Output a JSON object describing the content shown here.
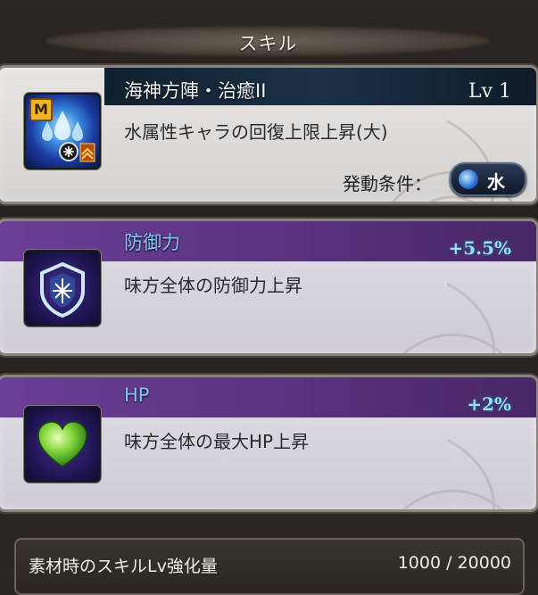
{
  "section": {
    "title": "スキル"
  },
  "skill": {
    "name": "海神方陣・治癒II",
    "level": "Lv 1",
    "badge": "M",
    "description": "水属性キャラの回復上限上昇(大)",
    "condition_label": "発動条件：",
    "element": "水",
    "icon": "water-skill-icon"
  },
  "effects": [
    {
      "name": "防御力",
      "value": "+5.5%",
      "description": "味方全体の防御力上昇",
      "icon": "shield-icon"
    },
    {
      "name": "HP",
      "value": "+2%",
      "description": "味方全体の最大HP上昇",
      "icon": "heart-icon"
    }
  ],
  "footer": {
    "label": "素材時のスキルLv強化量",
    "value": "1000 / 20000"
  },
  "colors": {
    "accent_purple": "#5a327f",
    "skill_header": "#1b3246",
    "effect_title": "#7ec8f5",
    "percent": "#8fe0ff"
  }
}
